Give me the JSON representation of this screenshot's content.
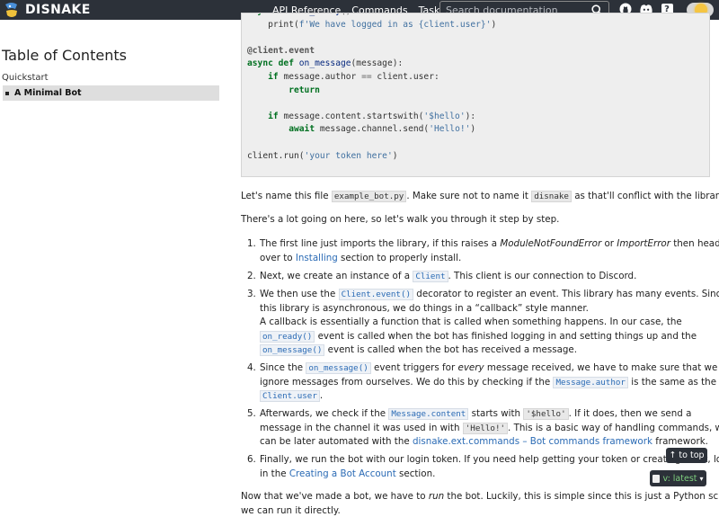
{
  "header": {
    "brand": "DISNAKE",
    "nav": [
      "API Reference",
      "Commands",
      "Tasks"
    ],
    "search_placeholder": "Search documentation",
    "help_label": "?"
  },
  "sidebar": {
    "title": "Table of Contents",
    "section": "Quickstart",
    "items": [
      {
        "label": "A Minimal Bot",
        "active": true
      }
    ]
  },
  "code_lines": [
    "async def on_ready():",
    "    print(f'We have logged in as {client.user}')",
    "",
    "@client.event",
    "async def on_message(message):",
    "    if message.author == client.user:",
    "        return",
    "",
    "    if message.content.startswith('$hello'):",
    "        await message.channel.send('Hello!')",
    "",
    "client.run('your token here')"
  ],
  "prose": {
    "p1_a": "Let's name this file ",
    "p1_code": "example_bot.py",
    "p1_b": ". Make sure not to name it ",
    "p1_code2": "disnake",
    "p1_c": " as that'll conflict with the library.",
    "p2": "There's a lot going on here, so let's walk you through it step by step.",
    "li1_a": "The first line just imports the library, if this raises a ",
    "li1_it1": "ModuleNotFoundError",
    "li1_b": " or ",
    "li1_it2": "ImportError",
    "li1_c": " then head on",
    "li1_d": "over to ",
    "li1_link": "Installing",
    "li1_e": " section to properly install.",
    "li2_a": "Next, we create an instance of a ",
    "li2_code": "Client",
    "li2_b": ". This client is our connection to Discord.",
    "li3_a": "We then use the ",
    "li3_code": "Client.event()",
    "li3_b": " decorator to register an event. This library has many events. Since",
    "li3_c": "this library is asynchronous, we do things in a “callback” style manner.",
    "li3_d": "A callback is essentially a function that is called when something happens. In our case, the",
    "li3_code2": "on_ready()",
    "li3_e": " event is called when the bot has finished logging in and setting things up and the",
    "li3_code3": "on_message()",
    "li3_f": " event is called when the bot has received a message.",
    "li4_a": "Since the ",
    "li4_code": "on_message()",
    "li4_b": " event triggers for ",
    "li4_it": "every",
    "li4_c": " message received, we have to make sure that we",
    "li4_d": "ignore messages from ourselves. We do this by checking if the ",
    "li4_code2": "Message.author",
    "li4_e": " is the same as the",
    "li4_code3": "Client.user",
    "li4_f": ".",
    "li5_a": "Afterwards, we check if the ",
    "li5_code": "Message.content",
    "li5_b": " starts with ",
    "li5_code2": "'$hello'",
    "li5_c": ". If it does, then we send a",
    "li5_d": "message in the channel it was used in with ",
    "li5_code3": "'Hello!'",
    "li5_e": ". This is a basic way of handling commands, which",
    "li5_f": "can be later automated with the ",
    "li5_link": "disnake.ext.commands – Bot commands framework",
    "li5_g": " framework.",
    "li6_a": "Finally, we run the bot with our login token. If you need help getting your token or creating a bot, look",
    "li6_b": "in the ",
    "li6_link": "Creating a Bot Account",
    "li6_c": " section.",
    "p3_a": "Now that we've made a bot, we have to ",
    "p3_it": "run",
    "p3_b": " the bot. Luckily, this is simple since this is just a Python script,",
    "p3_c": "we can run it directly."
  },
  "floating": {
    "to_top": "↑ to top",
    "version": "v: latest"
  }
}
